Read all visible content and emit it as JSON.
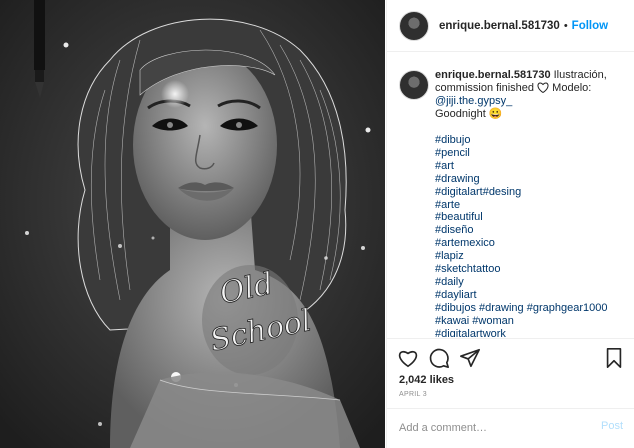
{
  "header": {
    "username": "enrique.bernal.581730",
    "separator": "•",
    "follow_label": "Follow"
  },
  "caption": {
    "username": "enrique.bernal.581730",
    "text_before_heart": "Ilustración, commission finished",
    "text_after_heart": "Modelo:",
    "mention": "@jiji.the.gypsy_",
    "closing": "Goodnight",
    "closing_emoji": "😀",
    "hashtags": [
      "#dibujo",
      "#pencil",
      "#art",
      "#drawing",
      "#digitalart#desing",
      "#arte",
      "#beautiful",
      "#diseño",
      "#artemexico",
      "#lapiz",
      "#sketchtattoo",
      "#daily",
      "#dayliart",
      "#dibujos #drawing #graphgear1000",
      "#kawai #woman",
      "#digitalartwork"
    ]
  },
  "artwork": {
    "tattoo_line1": "Old",
    "tattoo_line2": "School"
  },
  "actions": {
    "like_icon": "heart-outline-icon",
    "comment_icon": "comment-icon",
    "share_icon": "paper-plane-icon",
    "save_icon": "bookmark-icon"
  },
  "likes": "2,042 likes",
  "date": "APRIL 3",
  "comment": {
    "placeholder": "Add a comment…",
    "post_label": "Post"
  },
  "colors": {
    "accent": "#0095f6",
    "link": "#00376b",
    "muted": "#8e8e8e",
    "post_disabled": "#b2dffc"
  }
}
